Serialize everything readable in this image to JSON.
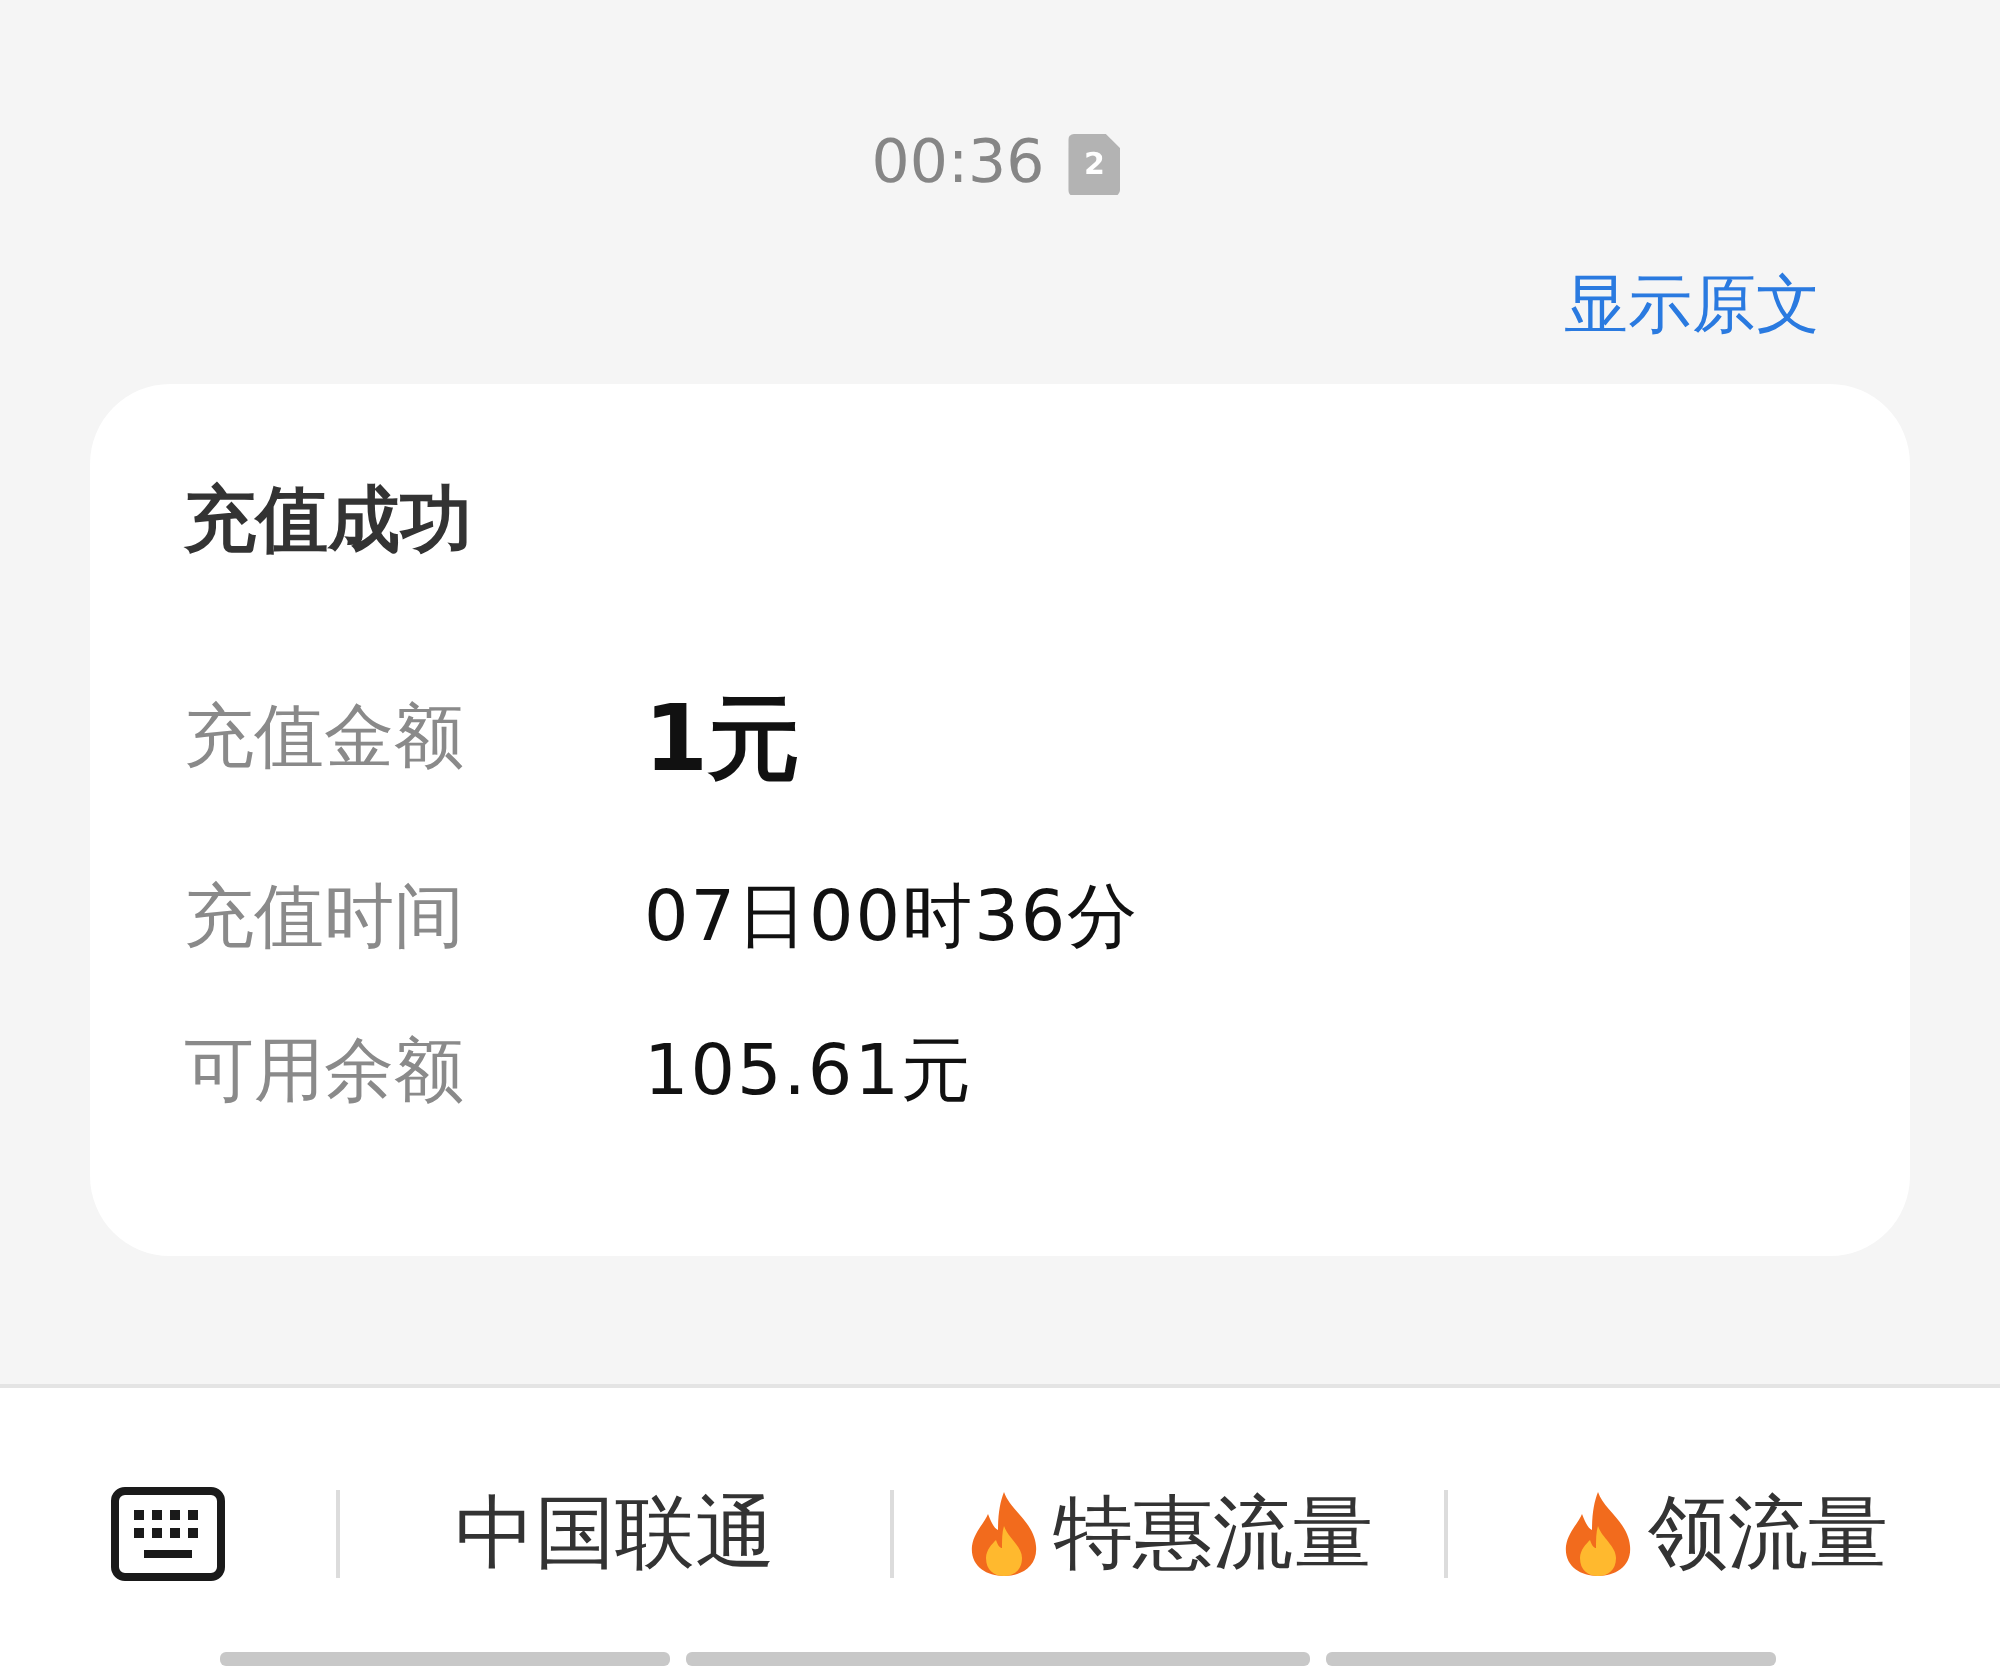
{
  "header": {
    "time": "00:36",
    "sim_slot": "2",
    "show_original_link": "显示原文"
  },
  "card": {
    "title": "充值成功",
    "rows": [
      {
        "kind": "amount",
        "label": "充值金额",
        "value": "1元"
      },
      {
        "kind": "plain",
        "label": "充值时间",
        "value": "07日00时36分"
      },
      {
        "kind": "plain",
        "label": "可用余额",
        "value": "105.61元"
      }
    ]
  },
  "menu_bar": {
    "items": [
      {
        "kind": "keyboard"
      },
      {
        "kind": "text",
        "label": "中国联通"
      },
      {
        "kind": "hot",
        "label": "特惠流量"
      },
      {
        "kind": "hot",
        "label": "领流量"
      }
    ]
  }
}
